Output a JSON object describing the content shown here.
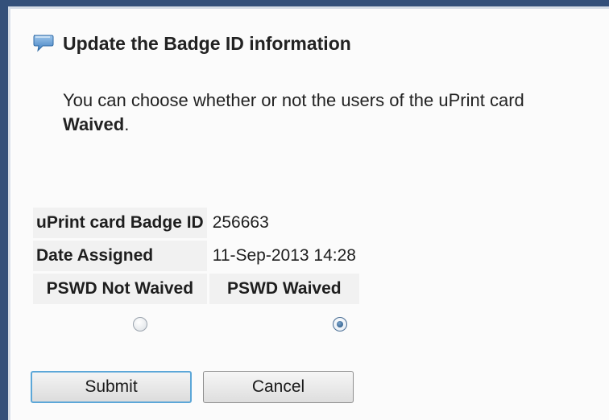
{
  "header": {
    "title": "Update the Badge ID information",
    "icon": "speech-bubble-icon"
  },
  "description": {
    "text_before": "You can choose whether or not the users of the uPrint card",
    "bold_text": "Waived",
    "text_after": "."
  },
  "badge_info": {
    "badge_id_label": "uPrint card Badge ID",
    "badge_id_value": "256663",
    "date_assigned_label": "Date Assigned",
    "date_assigned_value": "11-Sep-2013 14:28",
    "pswd_not_waived_label": "PSWD Not Waived",
    "pswd_waived_label": "PSWD Waived",
    "selected_option": "PSWD Waived"
  },
  "actions": {
    "submit_label": "Submit",
    "cancel_label": "Cancel"
  },
  "colors": {
    "frame": "#34507a",
    "submit_focus_border": "#5ca7d8"
  }
}
